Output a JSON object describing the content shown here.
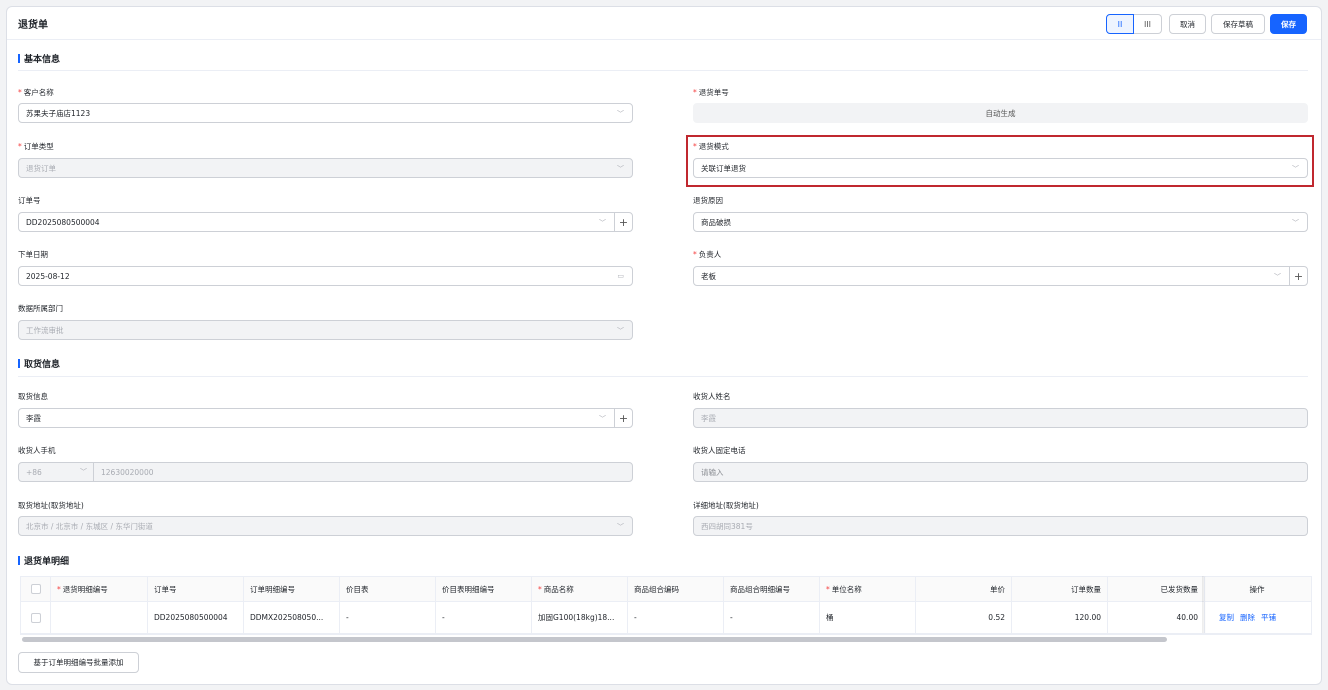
{
  "header": {
    "title": "退货单",
    "layout_two_label": "II",
    "layout_three_label": "III",
    "cancel_label": "取消",
    "save_draft_label": "保存草稿",
    "save_label": "保存"
  },
  "basic": {
    "section_title": "基本信息",
    "customer_name": {
      "label": "客户名称",
      "value": "苏果夫子庙店1123"
    },
    "return_no": {
      "label": "退货单号",
      "value": "自动生成"
    },
    "order_type": {
      "label": "订单类型",
      "value": "退货订单"
    },
    "return_mode": {
      "label": "退货模式",
      "value": "关联订单退货"
    },
    "order_no": {
      "label": "订单号",
      "value": "DD2025080500004"
    },
    "return_reason": {
      "label": "退货原因",
      "value": "商品破损"
    },
    "order_date": {
      "label": "下单日期",
      "value": "2025-08-12"
    },
    "owner": {
      "label": "负责人",
      "value": "老板"
    },
    "department": {
      "label": "数据所属部门",
      "value": "工作流审批"
    }
  },
  "pickup": {
    "section_title": "取货信息",
    "pickup_info": {
      "label": "取货信息",
      "value": "李霞"
    },
    "receiver_name": {
      "label": "收货人姓名",
      "value": "李霞"
    },
    "receiver_mobile": {
      "label": "收货人手机",
      "prefix": "+86",
      "value": "12630020000"
    },
    "receiver_phone": {
      "label": "收货人固定电话",
      "placeholder": "请输入"
    },
    "pickup_address": {
      "label": "取货地址(取货地址)",
      "value": "北京市 / 北京市 / 东城区 / 东华门街道"
    },
    "detail_address": {
      "label": "详细地址(取货地址)",
      "value": "西四胡同381号"
    }
  },
  "details": {
    "section_title": "退货单明细",
    "columns": [
      "退货明细编号",
      "订单号",
      "订单明细编号",
      "价目表",
      "价目表明细编号",
      "商品名称",
      "商品组合编码",
      "商品组合明细编号",
      "单位名称",
      "单价",
      "订单数量",
      "已发货数量",
      "操作"
    ],
    "rows": [
      {
        "detail_no": "",
        "order_no": "DD2025080500004",
        "order_detail_no": "DDMX202508050...",
        "price_list": "-",
        "price_list_detail": "-",
        "product_name": "加固G100(18kg)18...",
        "combo_code": "-",
        "combo_detail": "-",
        "unit": "桶",
        "price": "0.52",
        "order_qty": "120.00",
        "shipped_qty": "40.00",
        "actions": [
          "复制",
          "删除",
          "平铺"
        ]
      }
    ],
    "batch_add_label": "基于订单明细编号批量添加"
  },
  "colors": {
    "primary": "#1664ff",
    "required": "#f53f3f",
    "highlight": "#c0282f"
  }
}
